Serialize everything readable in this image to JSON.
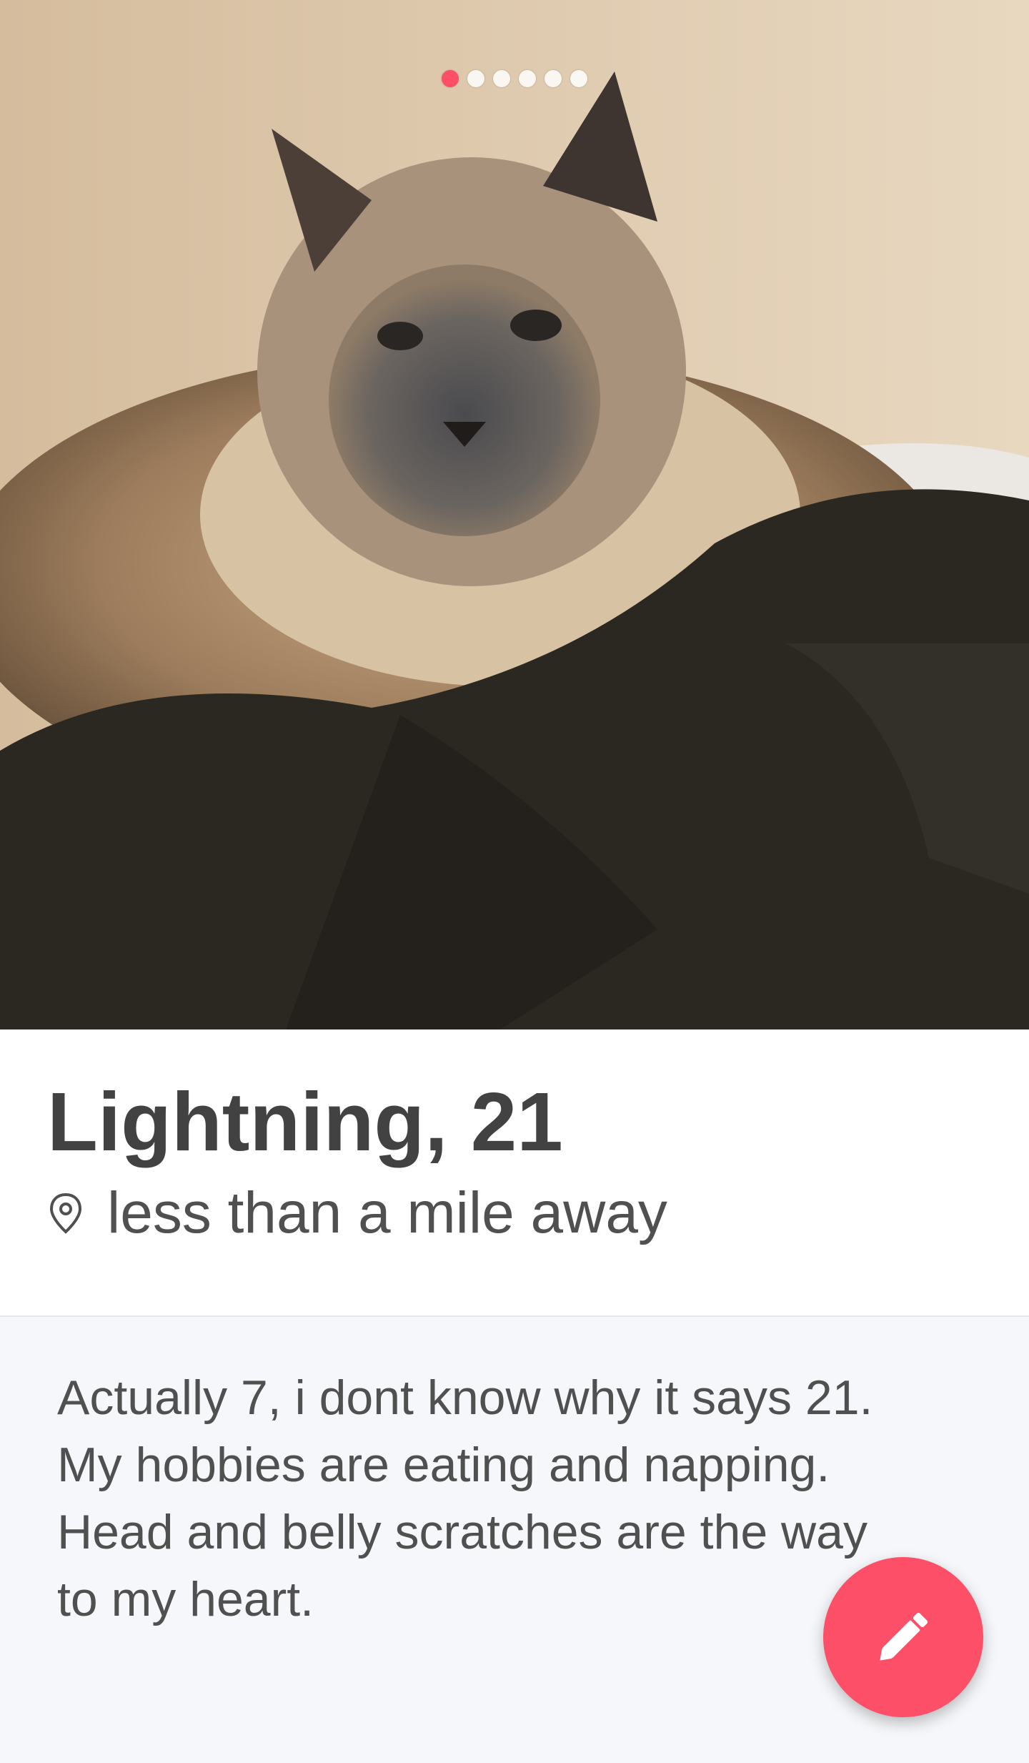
{
  "profile": {
    "name": "Lightning",
    "age": "21",
    "name_age": "Lightning, 21",
    "distance": "less than a mile away",
    "bio_lines": [
      "Actually 7, i dont know why it says 21.",
      "My hobbies are eating and napping.",
      "Head and belly scratches are the way",
      "to my heart."
    ]
  },
  "photos": {
    "count": 6,
    "active_index": 0
  },
  "colors": {
    "accent": "#fd5068",
    "text_primary": "#424242",
    "text_secondary": "#505050",
    "background": "#f6f7fa"
  },
  "icons": {
    "location": "map-pin-icon",
    "edit": "pencil-icon"
  }
}
